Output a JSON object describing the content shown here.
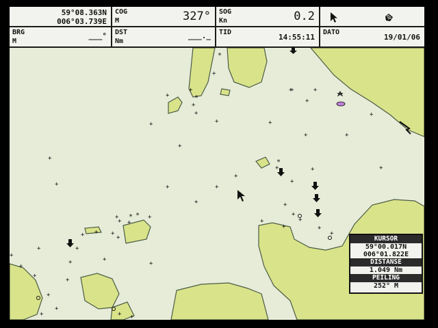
{
  "top_bar": {
    "position": {
      "lat": "59°08.363N",
      "lon": "006°03.739E"
    },
    "cog": {
      "label": "COG",
      "unit": "M",
      "value": "327°"
    },
    "sog": {
      "label": "SOG",
      "unit": "Kn",
      "value": "0.2"
    },
    "icons": [
      "pointer-arrow-icon",
      "hand-cursor-icon"
    ],
    "brg": {
      "label": "BRG",
      "unit": "M",
      "value": "___°"
    },
    "dst": {
      "label": "DST",
      "unit": "Nm",
      "value": "___._"
    },
    "tid": {
      "label": "TID",
      "value": "14:55:11"
    },
    "dato": {
      "label": "DATO",
      "value": "19/01/06"
    }
  },
  "cursor_box": {
    "title": "KURSOR",
    "lat": "59°00.017N",
    "lon": "006°01.822E",
    "dist_title": "DISTANSE",
    "dist_value": "1.049 Nm",
    "bearing_title": "PEILING",
    "bearing_value": "252° M"
  },
  "colors": {
    "sea": "#e6ecd8",
    "land": "#d9e38a",
    "coast": "#4a5a44",
    "bar_bg": "#f2f3ee",
    "marker": "#111111"
  }
}
